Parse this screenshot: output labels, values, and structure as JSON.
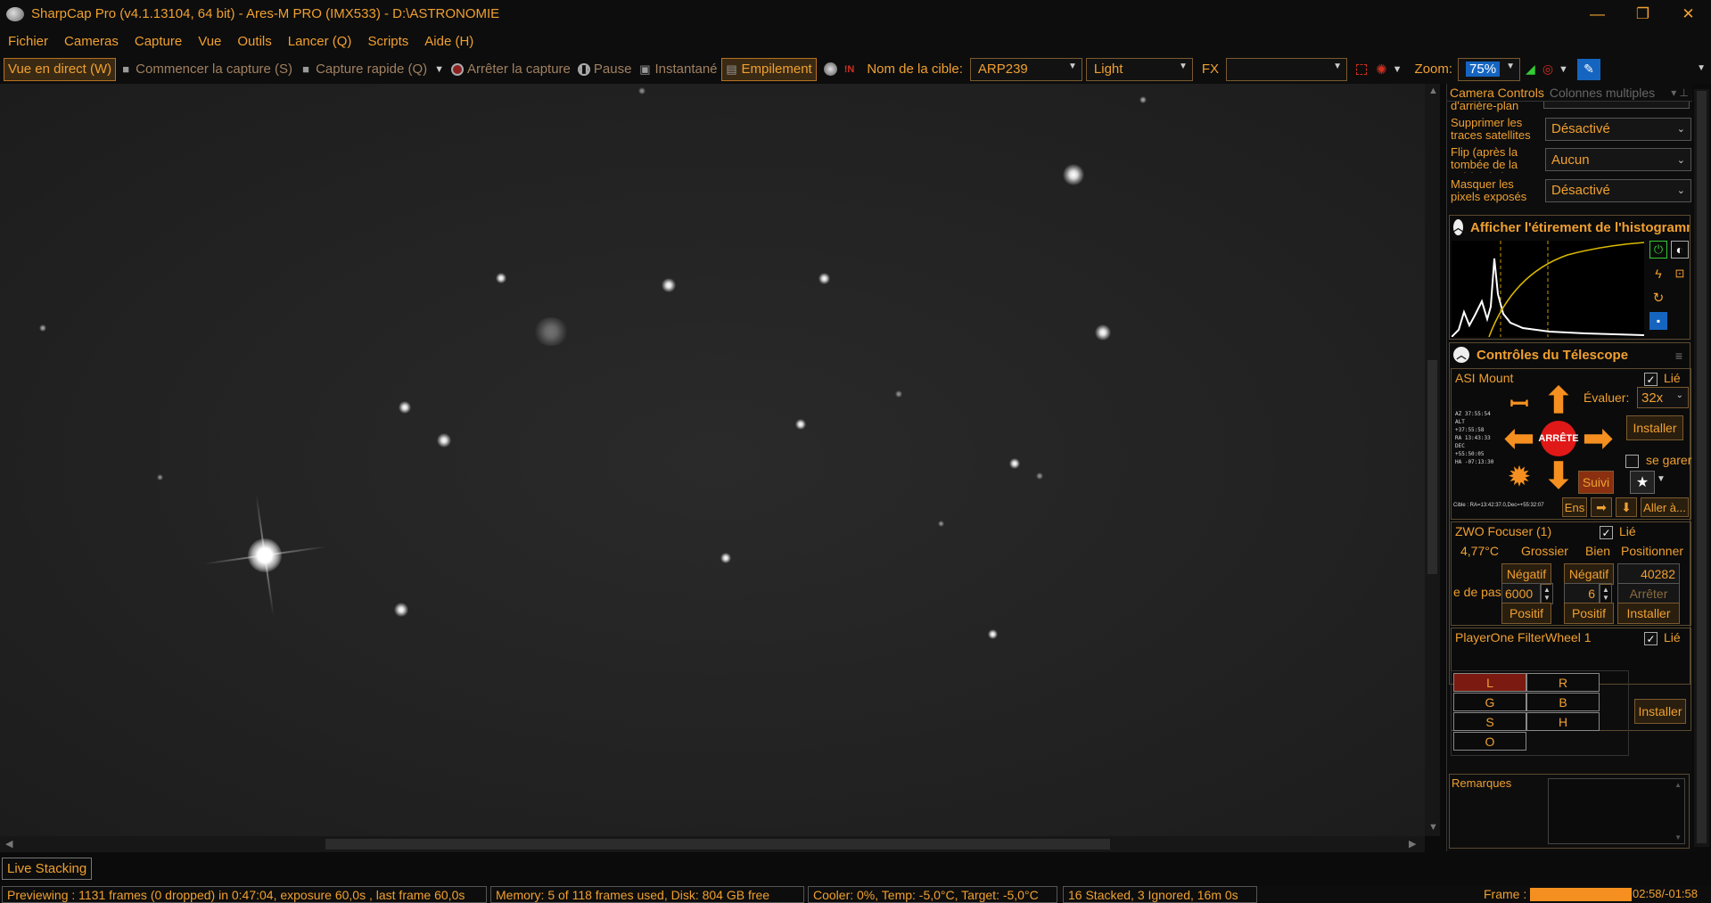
{
  "window": {
    "title": "SharpCap Pro (v4.1.13104, 64 bit) - Ares-M PRO (IMX533) - D:\\ASTRONOMIE",
    "minimize": "—",
    "restore": "❐",
    "close": "✕"
  },
  "menu": [
    "Fichier",
    "Cameras",
    "Capture",
    "Vue",
    "Outils",
    "Lancer (Q)",
    "Scripts",
    "Aide (H)"
  ],
  "toolbar": {
    "live_view": "Vue en direct (W)",
    "start_capture": "Commencer la capture (S)",
    "quick_capture": "Capture rapide (Q)",
    "stop_capture": "Arrêter la capture",
    "pause": "Pause",
    "snapshot": "Instantané",
    "stacking": "Empilement",
    "target_label": "Nom de la cible:",
    "target_value": "ARP239",
    "frame_type": "Light",
    "fx_label": "FX",
    "fx_value": "",
    "zoom_label": "Zoom:",
    "zoom_value": "75%"
  },
  "camera_panel": {
    "header": "Camera Controls",
    "columns_mode": "Colonnes multiples",
    "partial_label": "d'arrière-plan",
    "settings": [
      {
        "label": "Supprimer les traces satellites",
        "value": "Désactivé"
      },
      {
        "label": "Flip (après la tombée de la nuit/A plat)",
        "value": "Aucun"
      },
      {
        "label": "Masquer les pixels exposés",
        "value": "Désactivé"
      }
    ]
  },
  "histogram": {
    "title": "Afficher l'étirement de l'histogramme"
  },
  "telescope": {
    "title": "Contrôles du Télescope",
    "mount_name": "ASI Mount",
    "linked": "Lié",
    "rate_label": "Évaluer:",
    "rate_value": "32x",
    "install": "Installer",
    "park": "se garer",
    "stop": "ARRÊTE",
    "tracking": "Suivi",
    "set": "Ens",
    "goto": "Aller à...",
    "coords": [
      "AZ  37:55:54",
      "ALT +37:55:58",
      "RA  13:43:33",
      "DEC +55:50:05",
      "HA  -07:13:30"
    ],
    "target_line": "Cible : RA=13:42:37.0,Dec=+55:32:07"
  },
  "focuser": {
    "name": "ZWO Focuser (1)",
    "linked": "Lié",
    "temperature": "4,77°C",
    "coarse": "Grossier",
    "fine": "Bien",
    "position_label": "Positionner",
    "negative": "Négatif",
    "position_value": "40282",
    "step_label": "e de pas",
    "coarse_step": "6000",
    "fine_step": "6",
    "stop": "Arrêter",
    "positive": "Positif",
    "install": "Installer"
  },
  "filterwheel": {
    "name": "PlayerOne FilterWheel 1",
    "linked": "Lié",
    "filters": [
      "L",
      "R",
      "G",
      "B",
      "S",
      "H",
      "O"
    ],
    "selected": "L",
    "install": "Installer"
  },
  "notes": {
    "label": "Remarques"
  },
  "bottom_tab": "Live Stacking",
  "status": {
    "preview": "Previewing : 1131 frames (0 dropped) in 0:47:04, exposure 60,0s , last frame 60,0s",
    "memory": "Memory: 5 of 118 frames used, Disk: 804 GB free",
    "cooler": "Cooler: 0%, Temp: -5,0°C, Target: -5,0°C",
    "stack": "16 Stacked, 3 Ignored, 16m 0s",
    "frame_label": "Frame :",
    "frame_progress": 1.0,
    "frame_time": "02:58/-01:58"
  },
  "colors": {
    "accent": "#f0a030",
    "background": "#0d0d0d",
    "selected_filter": "#7a1a10",
    "stop": "#e01818",
    "zoom_highlight": "#1565c0"
  }
}
